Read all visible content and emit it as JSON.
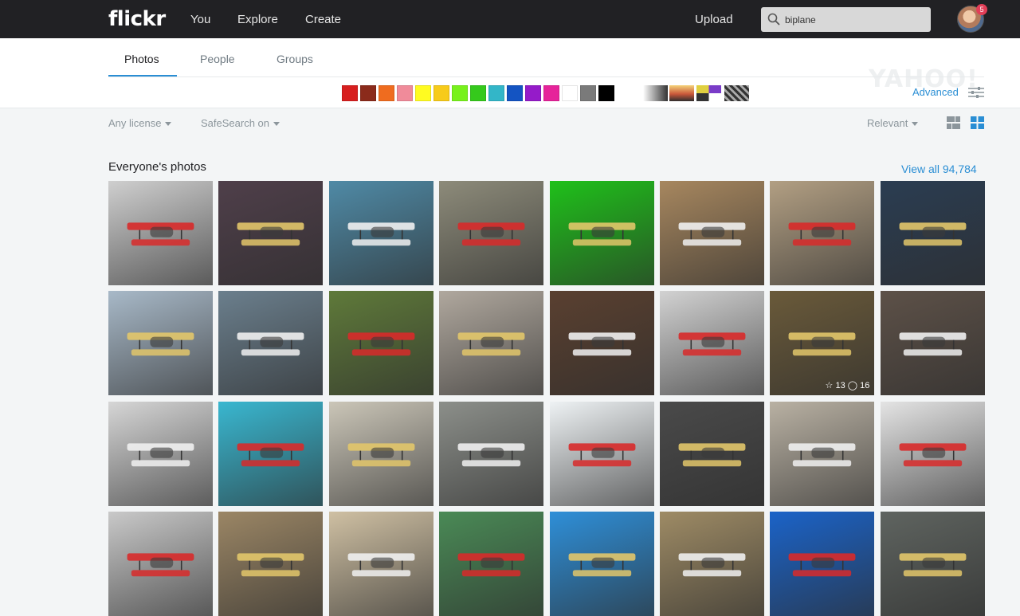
{
  "topbar": {
    "logo": "flickr",
    "nav": [
      "You",
      "Explore",
      "Create"
    ],
    "upload_label": "Upload",
    "search_value": "biplane",
    "notification_count": "5",
    "watermark": "YAHOO!"
  },
  "subnav": {
    "tabs": [
      {
        "label": "Photos",
        "active": true
      },
      {
        "label": "People",
        "active": false
      },
      {
        "label": "Groups",
        "active": false
      }
    ],
    "color_swatches": [
      "#d71f1f",
      "#8b2b1b",
      "#ef6c1f",
      "#f08b9a",
      "#fffb21",
      "#f7cb1a",
      "#78f11c",
      "#35c91c",
      "#33b6c8",
      "#1454c2",
      "#951bc9",
      "#e6239a",
      "#ffffff",
      "#7a7a7a",
      "#000000"
    ],
    "style_swatches": [
      "black-and-white",
      "shallow-depth-of-field",
      "minimalist",
      "patterns"
    ],
    "advanced_label": "Advanced"
  },
  "filters": {
    "license": "Any license",
    "safesearch": "SafeSearch on",
    "sort": "Relevant"
  },
  "results": {
    "title": "Everyone's photos",
    "view_all": "View all 94,784",
    "faves_count": "13",
    "comments_count": "16",
    "thumb_colors": [
      [
        "#cfcfcf",
        "#4f3f4a",
        "#4f8aa6",
        "#8d8b7a",
        "#1fc11a",
        "#a7875f",
        "#b29f83",
        "#2b3d52"
      ],
      [
        "#a8b9c8",
        "#6b7f8d",
        "#5f7a3a",
        "#b0a89e",
        "#5a4030",
        "#d2d2d2",
        "#6a5a3a",
        "#5d5148"
      ],
      [
        "#d6d6d6",
        "#39b7d0",
        "#cbc6b8",
        "#8c8f8a",
        "#eef2f4",
        "#4a4a4a",
        "#b9b1a3",
        "#e4e4e4"
      ],
      [
        "#c9c9c9",
        "#9b8665",
        "#cfc0a3",
        "#4a8a56",
        "#2e8fd8",
        "#9e8b65",
        "#1b63c8",
        "#5f6460"
      ]
    ]
  }
}
